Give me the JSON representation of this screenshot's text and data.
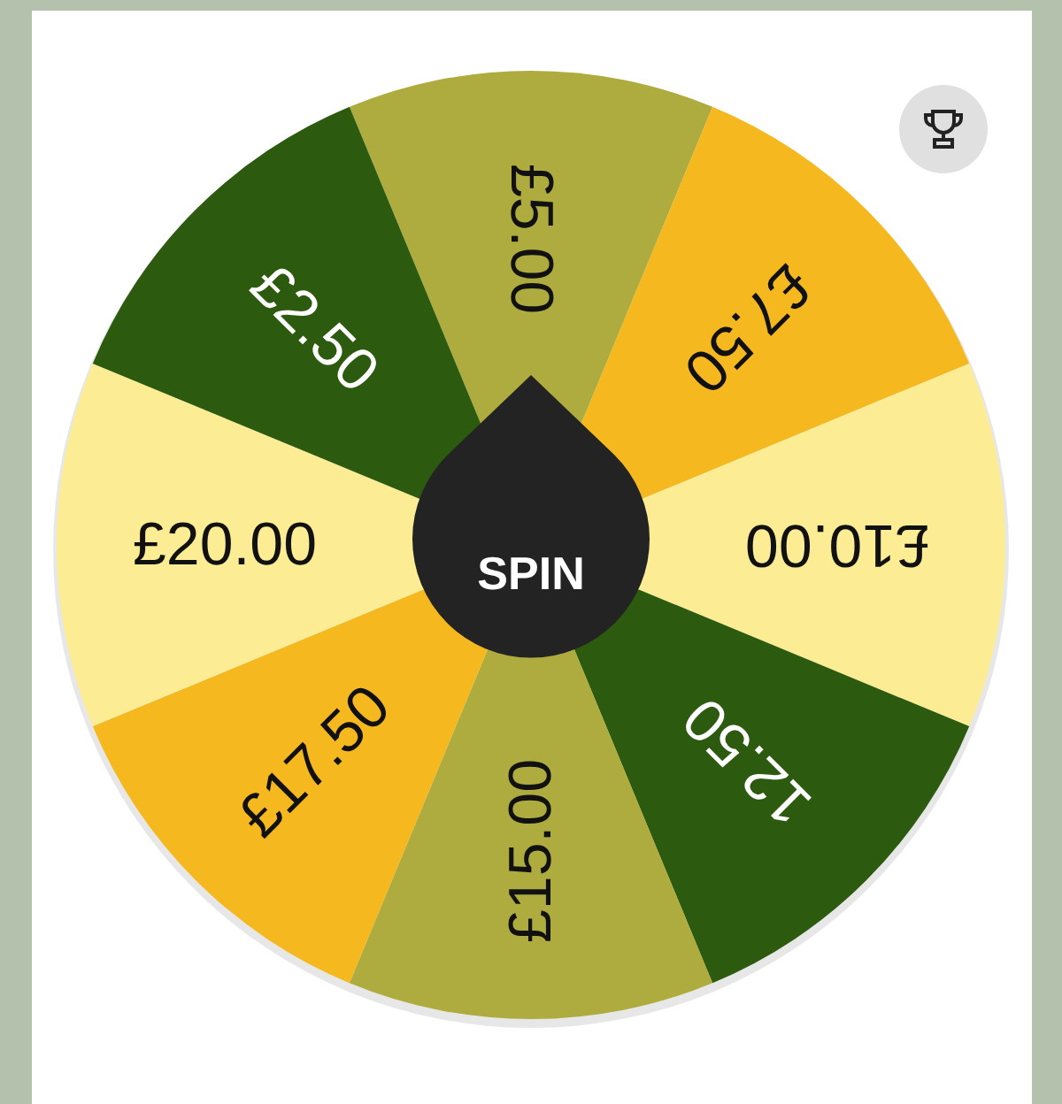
{
  "wheel": {
    "segments": [
      {
        "label": "£5.00",
        "color": "#aeac3f"
      },
      {
        "label": "£7.50",
        "color": "#f6b81f"
      },
      {
        "label": "£10.00",
        "color": "#fcec94"
      },
      {
        "label": "12.50",
        "color": "#2c5a0e"
      },
      {
        "label": "£15.00",
        "color": "#aeac3f"
      },
      {
        "label": "£17.50",
        "color": "#f6b81f"
      },
      {
        "label": "£20.00",
        "color": "#fcec94"
      },
      {
        "label": "£2.50",
        "color": "#2c5a0e"
      }
    ]
  },
  "spin_button": {
    "label": "SPIN"
  }
}
